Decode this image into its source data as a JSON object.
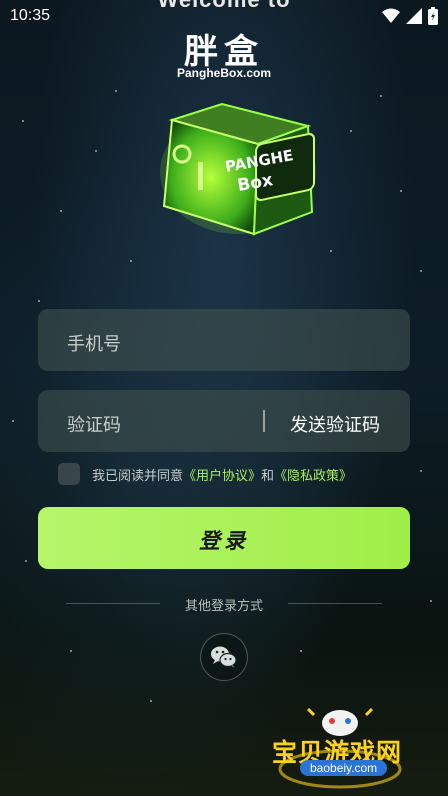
{
  "status_bar": {
    "time": "10:35"
  },
  "header": {
    "welcome_text": "Welcome to",
    "logo_cn": "胖盒",
    "logo_en": "PangheBox.com"
  },
  "cube": {
    "label_line1": "PANGHE",
    "label_line2": "Box"
  },
  "form": {
    "phone_placeholder": "手机号",
    "code_placeholder": "验证码",
    "send_code_label": "发送验证码"
  },
  "agreement": {
    "prefix": "我已阅读并同意",
    "user_agreement": "《用户协议》",
    "and": "和",
    "privacy_policy": "《隐私政策》",
    "checked": false
  },
  "login": {
    "label": "登录"
  },
  "other_login": {
    "label": "其他登录方式",
    "methods": [
      "wechat-icon"
    ]
  },
  "watermark": {
    "cn": "宝贝游戏网",
    "en": "baobeiy.com"
  },
  "colors": {
    "accent": "#a8f062",
    "button": "#b2f464",
    "background": "#0d1d28"
  }
}
